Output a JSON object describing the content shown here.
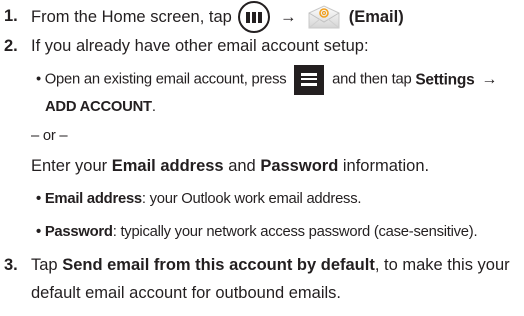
{
  "steps": {
    "s1": {
      "number": "1.",
      "text_before": "From the Home screen, tap",
      "arrow": "→",
      "email_label": "(Email)",
      "icons": [
        "apps-icon",
        "email-icon"
      ]
    },
    "s2": {
      "number": "2.",
      "text": "If you already have other email account setup:",
      "bullet_prefix": "• Open an existing email account, press",
      "bullet_mid": "and then tap",
      "settings_label": "Settings",
      "arrow": "→",
      "add_account_label": "ADD ACCOUNT",
      "period": ".",
      "or_text": "– or –",
      "enter_prefix": "Enter your",
      "email_address_label": "Email address",
      "and_text": "and",
      "password_label": "Password",
      "information_text": "information.",
      "menu_icon": "menu-icon",
      "bullets": [
        {
          "term": "Email address",
          "desc": ": your Outlook work email address."
        },
        {
          "term": "Password",
          "desc": ": typically your network access password (case-sensitive)."
        }
      ],
      "bullet_mark": "•"
    },
    "s3": {
      "number": "3.",
      "tap_text": "Tap",
      "bold_text": "Send email from this account by default",
      "rest_line1": ", to make this your",
      "line2": "default email account for outbound emails."
    }
  },
  "colors": {
    "text": "#231f20",
    "email_icon_envelope": "#e8e8e8",
    "email_icon_at": "#f0a020"
  }
}
